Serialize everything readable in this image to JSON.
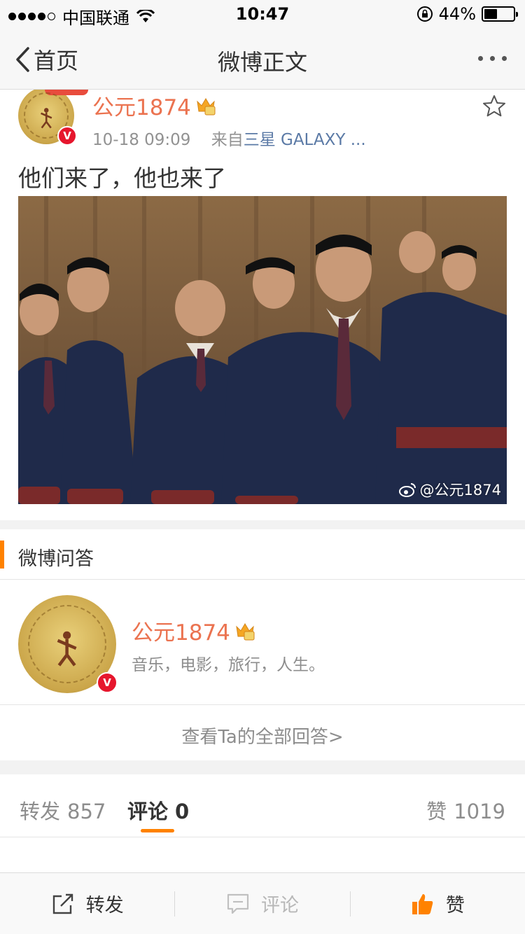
{
  "status_bar": {
    "carrier": "中国联通",
    "time": "10:47",
    "battery_percent": "44%",
    "battery_level": 0.44,
    "signal_bars": 4
  },
  "nav": {
    "back_label": "首页",
    "title": "微博正文"
  },
  "post": {
    "author": "公元1874",
    "timestamp": "10-18 09:09",
    "source_prefix": "来自",
    "source": "三星 GALAXY ...",
    "text": "他们来了，他也来了",
    "watermark": "@公元1874",
    "verified_badge": "V"
  },
  "qa": {
    "section_title": "微博问答",
    "author": "公元1874",
    "bio": "音乐，电影，旅行，人生。",
    "view_all_link": "查看Ta的全部回答>",
    "verified_badge": "V"
  },
  "tabs": {
    "repost_label": "转发",
    "repost_count": "857",
    "comment_label": "评论",
    "comment_count": "0",
    "like_label": "赞",
    "like_count": "1019",
    "active": "comment"
  },
  "toolbar": {
    "repost_label": "转发",
    "comment_label": "评论",
    "like_label": "赞"
  },
  "colors": {
    "accent": "#ff8200",
    "username": "#eb7350",
    "link": "#5b7aa6",
    "verified": "#e6162d"
  },
  "icons": [
    "back-chevron-icon",
    "wifi-icon",
    "rotation-lock-icon",
    "more-icon",
    "star-icon",
    "crown-icon",
    "weibo-logo-icon",
    "share-icon",
    "comment-icon",
    "thumbs-up-icon"
  ]
}
